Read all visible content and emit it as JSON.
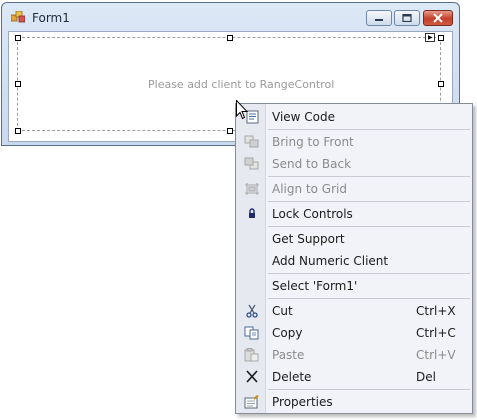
{
  "window": {
    "title": "Form1"
  },
  "range_control": {
    "placeholder": "Please add client to RangeControl"
  },
  "menu": {
    "view_code": "View Code",
    "bring_to_front": "Bring to Front",
    "send_to_back": "Send to Back",
    "align_to_grid": "Align to Grid",
    "lock_controls": "Lock Controls",
    "get_support": "Get Support",
    "add_numeric_client": "Add Numeric Client",
    "select_form": "Select 'Form1'",
    "cut": "Cut",
    "cut_shortcut": "Ctrl+X",
    "copy": "Copy",
    "copy_shortcut": "Ctrl+C",
    "paste": "Paste",
    "paste_shortcut": "Ctrl+V",
    "delete": "Delete",
    "delete_shortcut": "Del",
    "properties": "Properties"
  }
}
